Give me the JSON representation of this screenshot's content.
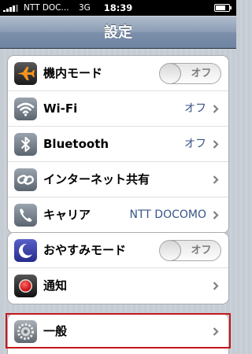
{
  "status_bar": {
    "carrier": "NTT DOC...",
    "network": "3G",
    "time": "18:39"
  },
  "nav": {
    "title": "設定"
  },
  "group1": [
    {
      "icon": "airplane-icon",
      "label": "機内モード",
      "control": "switch",
      "value": "オフ"
    },
    {
      "icon": "wifi-icon",
      "label": "Wi-Fi",
      "control": "value",
      "value": "オフ"
    },
    {
      "icon": "bluetooth-icon",
      "label": "Bluetooth",
      "control": "value",
      "value": "オフ"
    },
    {
      "icon": "link-icon",
      "label": "インターネット共有",
      "control": "chevron"
    },
    {
      "icon": "phone-icon",
      "label": "キャリア",
      "control": "value",
      "value": "NTT DOCOMO"
    }
  ],
  "group2": [
    {
      "icon": "moon-icon",
      "label": "おやすみモード",
      "control": "switch",
      "value": "オフ"
    },
    {
      "icon": "notification-icon",
      "label": "通知",
      "control": "chevron"
    }
  ],
  "group3": [
    {
      "icon": "gear-icon",
      "label": "一般",
      "control": "chevron"
    }
  ],
  "colors": {
    "nav_gradient_top": "#b0bccd",
    "value_text": "#385487",
    "highlight": "#c4161c"
  }
}
